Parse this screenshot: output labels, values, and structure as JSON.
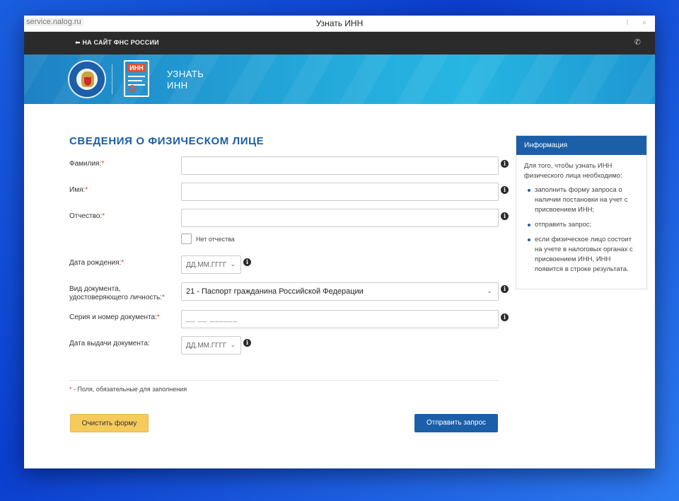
{
  "browser": {
    "url": "service.nalog.ru",
    "title": "Узнать ИНН"
  },
  "topbar": {
    "back_link": "НА САЙТ ФНС РОССИИ",
    "back_icon": "arrow-left-icon",
    "phone_icon": "phone-icon"
  },
  "banner": {
    "service_title_line1": "УЗНАТЬ",
    "service_title_line2": "ИНН",
    "doc_badge": "ИНН"
  },
  "form": {
    "heading": "СВЕДЕНИЯ О ФИЗИЧЕСКОМ ЛИЦЕ",
    "required_mark": "*",
    "fields": {
      "surname_label": "Фамилия:",
      "name_label": "Имя:",
      "patronymic_label": "Отчество:",
      "no_patronymic_label": "Нет отчества",
      "birthdate_label": "Дата рождения:",
      "birthdate_placeholder": "ДД.ММ.ГГГГ",
      "doctype_label_line1": "Вид документа,",
      "doctype_label_line2": "удостоверяющего личность:",
      "doctype_value": "21 - Паспорт гражданина Российской Федерации",
      "docnum_label": "Серия и номер документа:",
      "docnum_placeholder": "__ __ ______",
      "issue_date_label": "Дата выдачи документа:",
      "issue_date_placeholder": "ДД.ММ.ГГГГ"
    },
    "note_mark": "*",
    "note_text": " - Поля, обязательные для заполнения",
    "clear_button": "Очистить форму",
    "submit_button": "Отправить запрос"
  },
  "info_panel": {
    "title": "Информация",
    "intro": "Для того, чтобы узнать ИНН физического лица необходимо:",
    "items": [
      "заполнить форму запроса о наличии постановки на учет с присвоением ИНН;",
      "отправить запрос;",
      "если физическое лицо состоит на учете в налоговых органах с присвоением ИНН, ИНН появится в строке результата."
    ]
  },
  "colors": {
    "brand_blue": "#1b5fa8",
    "required_red": "#e53935",
    "clear_yellow": "#f5cb5c",
    "topbar_dark": "#2b2b2b"
  }
}
